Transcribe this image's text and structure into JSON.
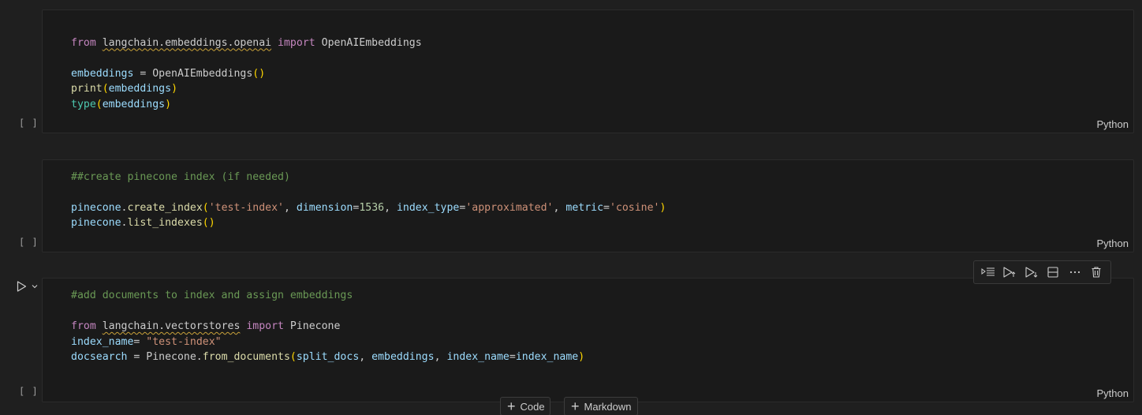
{
  "cells": [
    {
      "exec_marker": "[ ]",
      "language": "Python",
      "lines": [
        [],
        [
          [
            "kw",
            "from"
          ],
          [
            "t",
            " "
          ],
          [
            "sq",
            "langchain.embeddings.openai"
          ],
          [
            "t",
            " "
          ],
          [
            "kw",
            "import"
          ],
          [
            "t",
            " OpenAIEmbeddings"
          ]
        ],
        [],
        [
          [
            "var",
            "embeddings"
          ],
          [
            "t",
            " = OpenAIEmbeddings"
          ],
          [
            "br",
            "()"
          ]
        ],
        [
          [
            "fn",
            "print"
          ],
          [
            "br",
            "("
          ],
          [
            "var",
            "embeddings"
          ],
          [
            "br",
            ")"
          ]
        ],
        [
          [
            "bi",
            "type"
          ],
          [
            "br",
            "("
          ],
          [
            "var",
            "embeddings"
          ],
          [
            "br",
            ")"
          ]
        ]
      ]
    },
    {
      "exec_marker": "[ ]",
      "language": "Python",
      "lines": [
        [],
        [
          [
            "cm",
            "##create pinecone index (if needed)"
          ]
        ],
        [],
        [
          [
            "var",
            "pinecone"
          ],
          [
            "t",
            "."
          ],
          [
            "fn",
            "create_index"
          ],
          [
            "br",
            "("
          ],
          [
            "str",
            "'test-index'"
          ],
          [
            "t",
            ", "
          ],
          [
            "var",
            "dimension"
          ],
          [
            "t",
            "="
          ],
          [
            "num",
            "1536"
          ],
          [
            "t",
            ", "
          ],
          [
            "var",
            "index_type"
          ],
          [
            "t",
            "="
          ],
          [
            "str",
            "'approximated'"
          ],
          [
            "t",
            ", "
          ],
          [
            "var",
            "metric"
          ],
          [
            "t",
            "="
          ],
          [
            "str",
            "'cosine'"
          ],
          [
            "br",
            ")"
          ]
        ],
        [
          [
            "var",
            "pinecone"
          ],
          [
            "t",
            "."
          ],
          [
            "fn",
            "list_indexes"
          ],
          [
            "br",
            "()"
          ]
        ]
      ]
    },
    {
      "exec_marker": "[ ]",
      "language": "Python",
      "lines": [
        [
          [
            "cm",
            "#add documents to index and assign embeddings"
          ]
        ],
        [],
        [
          [
            "kw",
            "from"
          ],
          [
            "t",
            " "
          ],
          [
            "sq",
            "langchain.vectorstores"
          ],
          [
            "t",
            " "
          ],
          [
            "kw",
            "import"
          ],
          [
            "t",
            " Pinecone"
          ]
        ],
        [
          [
            "var",
            "index_name"
          ],
          [
            "t",
            "= "
          ],
          [
            "str",
            "\"test-index\""
          ]
        ],
        [
          [
            "var",
            "docsearch"
          ],
          [
            "t",
            " = Pinecone."
          ],
          [
            "fn",
            "from_documents"
          ],
          [
            "br",
            "("
          ],
          [
            "var",
            "split_docs"
          ],
          [
            "t",
            ", "
          ],
          [
            "var",
            "embeddings"
          ],
          [
            "t",
            ", "
          ],
          [
            "var",
            "index_name"
          ],
          [
            "t",
            "="
          ],
          [
            "var",
            "index_name"
          ],
          [
            "br",
            ")"
          ]
        ]
      ]
    }
  ],
  "toolbar": {
    "icons": [
      "execute-above-icon",
      "run-above-icon",
      "run-below-icon",
      "split-cell-icon",
      "more-icon",
      "delete-icon"
    ]
  },
  "add_buttons": {
    "code_label": "Code",
    "markdown_label": "Markdown"
  },
  "colors": {
    "background": "#1f1f1f",
    "cell_background": "#1a1a1a",
    "keyword": "#c586c0",
    "variable": "#9cdcfe",
    "function": "#dcdcaa",
    "builtin": "#4ec9b0",
    "bracket": "#ffd700",
    "string": "#ce9178",
    "number": "#b5cea8",
    "comment": "#6a9955"
  }
}
